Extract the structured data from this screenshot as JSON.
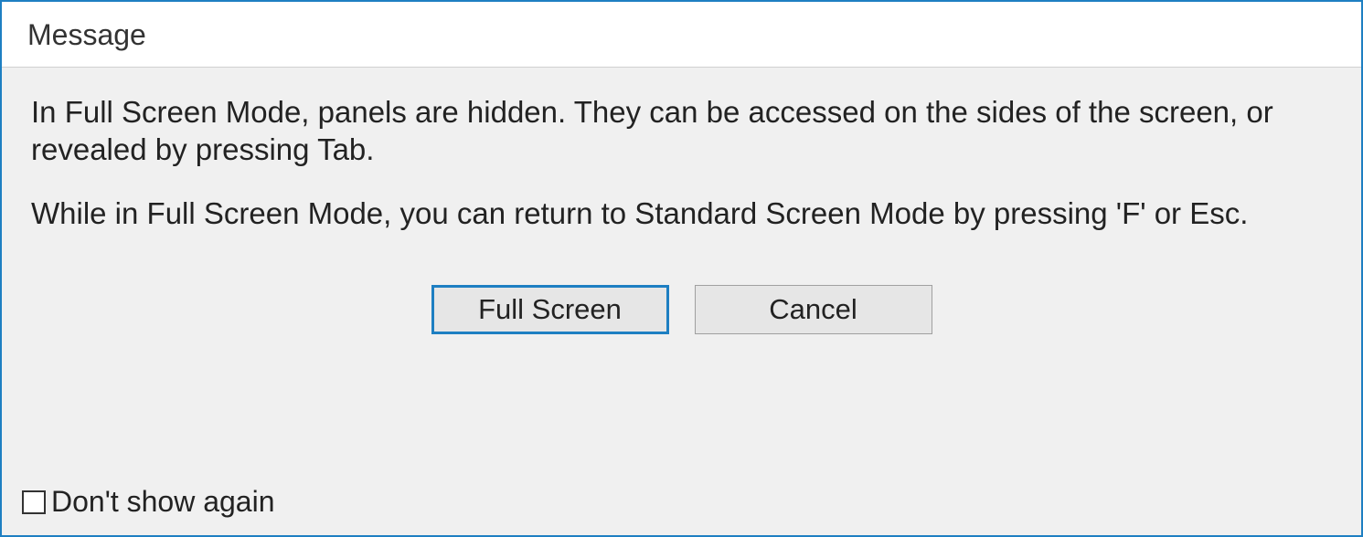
{
  "dialog": {
    "title": "Message",
    "paragraph1": "In Full Screen Mode, panels are hidden. They can be accessed on the sides of the screen, or revealed by pressing Tab.",
    "paragraph2": "While in Full Screen Mode, you can return to Standard Screen Mode by pressing 'F' or Esc.",
    "buttons": {
      "primary": "Full Screen",
      "cancel": "Cancel"
    },
    "checkbox_label": "Don't show again"
  }
}
